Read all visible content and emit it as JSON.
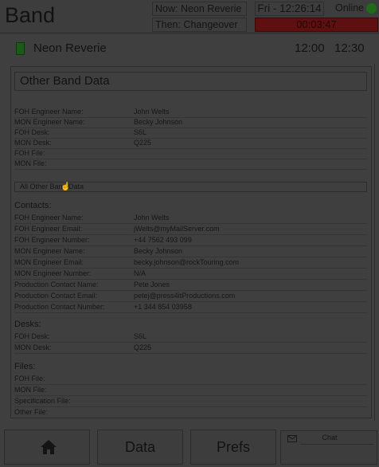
{
  "header": {
    "title": "Band",
    "now": "Now: Neon Reverie",
    "then": "Then: Changeover",
    "clock": "Fri - 12:26:14",
    "online": "Online",
    "countdown": "00:03:47"
  },
  "current_band": {
    "name": "Neon Reverie",
    "start": "12:00",
    "end": "12:30"
  },
  "panel": {
    "title": "Other Band Data",
    "summary": [
      {
        "label": "FOH Engineer Name:",
        "value": "John Welts"
      },
      {
        "label": "MON Engineer Name:",
        "value": "Becky Johnson"
      },
      {
        "label": "FOH Desk:",
        "value": "S6L"
      },
      {
        "label": "MON Desk:",
        "value": "Q225"
      },
      {
        "label": "FOH File:",
        "value": ""
      },
      {
        "label": "MON File:",
        "value": ""
      }
    ],
    "all_data_button": "All Other Band Data",
    "contacts_title": "Contacts:",
    "contacts": [
      {
        "label": "FOH Engineer Name:",
        "value": "John Welts"
      },
      {
        "label": "FOH Engineer Email:",
        "value": "jWelts@myMailServer.com"
      },
      {
        "label": "FOH Engineer Number:",
        "value": "+44 7562 493 099"
      },
      {
        "label": "MON Engineer Name:",
        "value": "Becky Johnson"
      },
      {
        "label": "MON Engineer Email:",
        "value": "becky.johnson@rockTouring.com"
      },
      {
        "label": "MON Engineer Number:",
        "value": "N/A"
      },
      {
        "label": "Production Contact Name:",
        "value": "Pete Jones"
      },
      {
        "label": "Production Contact Email:",
        "value": "petej@press4itProductions.com"
      },
      {
        "label": "Production Contact Number:",
        "value": "+1 344 854 03958"
      }
    ],
    "desks_title": "Desks:",
    "desks": [
      {
        "label": "FOH Desk:",
        "value": "S6L"
      },
      {
        "label": "MON Desk:",
        "value": "Q225"
      }
    ],
    "files_title": "Files:",
    "files": [
      {
        "label": "FOH File:",
        "value": ""
      },
      {
        "label": "MON File:",
        "value": ""
      },
      {
        "label": "Specification File:",
        "value": ""
      },
      {
        "label": "Other File:",
        "value": ""
      }
    ]
  },
  "nav": {
    "data": "Data",
    "prefs": "Prefs",
    "chat": "Chat"
  },
  "colors": {
    "online": "#1f6b18",
    "countdown_bg": "#5e0f0f",
    "band_status": "#1b5a18"
  },
  "icons": [
    "home-icon",
    "mail-icon",
    "online-indicator",
    "band-status-indicator",
    "cursor-icon"
  ]
}
